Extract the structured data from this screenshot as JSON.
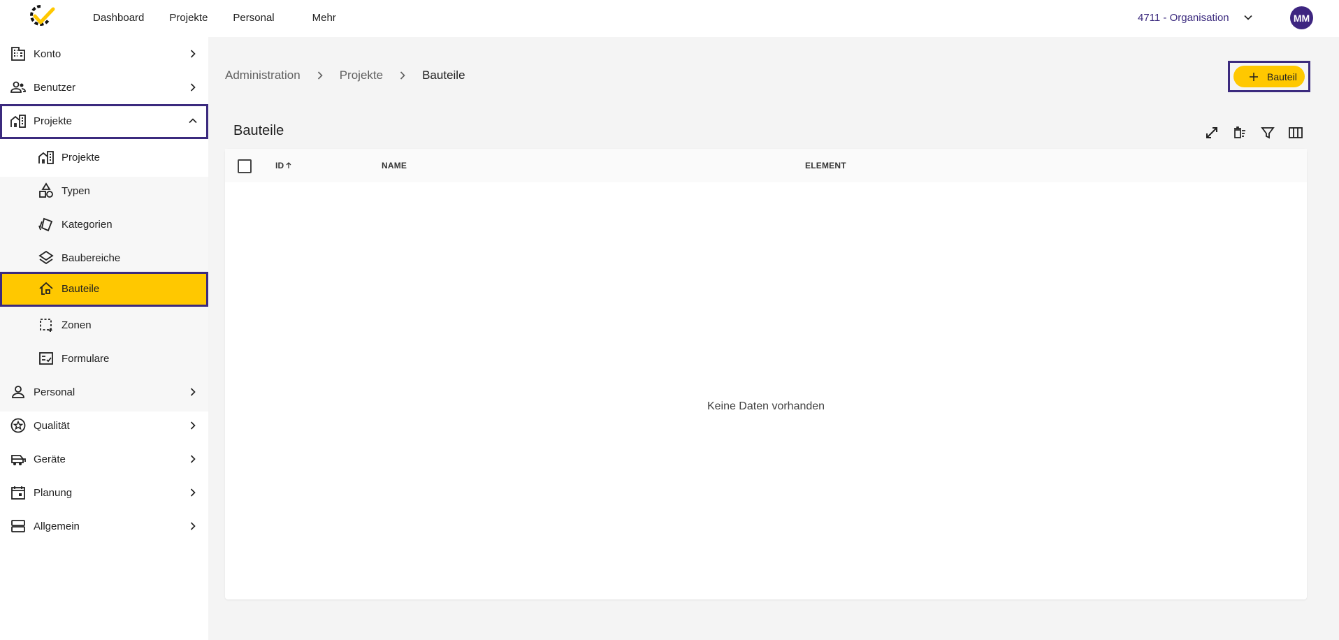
{
  "topnav": {
    "items": [
      "Dashboard",
      "Projekte",
      "Personal",
      "Mehr"
    ],
    "organisation": "4711 - Organisation",
    "avatar_initials": "MM"
  },
  "sidebar": {
    "items": [
      {
        "label": "Konto",
        "icon": "building-icon"
      },
      {
        "label": "Benutzer",
        "icon": "users-icon"
      },
      {
        "label": "Projekte",
        "icon": "city-icon"
      },
      {
        "label": "Personal",
        "icon": "person-icon"
      },
      {
        "label": "Qualität",
        "icon": "star-badge-icon"
      },
      {
        "label": "Geräte",
        "icon": "machine-icon"
      },
      {
        "label": "Planung",
        "icon": "calendar-icon"
      },
      {
        "label": "Allgemein",
        "icon": "storage-icon"
      }
    ],
    "subitems": [
      {
        "label": "Projekte",
        "icon": "city-icon"
      },
      {
        "label": "Typen",
        "icon": "shapes-icon"
      },
      {
        "label": "Kategorien",
        "icon": "cards-icon"
      },
      {
        "label": "Baubereiche",
        "icon": "layers-icon"
      },
      {
        "label": "Bauteile",
        "icon": "house-icon"
      },
      {
        "label": "Zonen",
        "icon": "selection-icon"
      },
      {
        "label": "Formulare",
        "icon": "checklist-icon"
      }
    ]
  },
  "breadcrumb": [
    "Administration",
    "Projekte",
    "Bauteile"
  ],
  "add_button_label": "Bauteil",
  "table": {
    "title": "Bauteile",
    "columns": [
      "ID",
      "NAME",
      "ELEMENT"
    ],
    "empty_text": "Keine Daten vorhanden"
  },
  "colors": {
    "accent": "#ffc800",
    "brand": "#3b2a7e"
  }
}
